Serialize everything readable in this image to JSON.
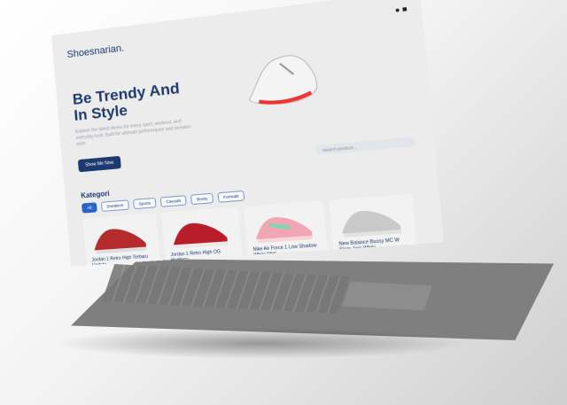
{
  "brand": {
    "name": "Shoes",
    "suffix": "narian."
  },
  "hero": {
    "title": "Be Trendy And In Style",
    "subtitle": "Explore the latest shoes for every sport, workout, and everyday look. Built for ultimate performance and sneaker style.",
    "cta": "Show Me Now"
  },
  "search": {
    "placeholder": "Search product..."
  },
  "categories_title": "Kategori",
  "chips": [
    "All",
    "Sneakers",
    "Sports",
    "Casuals",
    "Boots",
    "Formals"
  ],
  "products": [
    {
      "name": "Jordan 1 Retro High Terbaru Update"
    },
    {
      "name": "Jordan 1 Retro High OG Heritage"
    },
    {
      "name": "Nike Air Force 1 Low Shadow White Mint"
    },
    {
      "name": "New Balance Bussy MC W Slam Jam White"
    }
  ]
}
